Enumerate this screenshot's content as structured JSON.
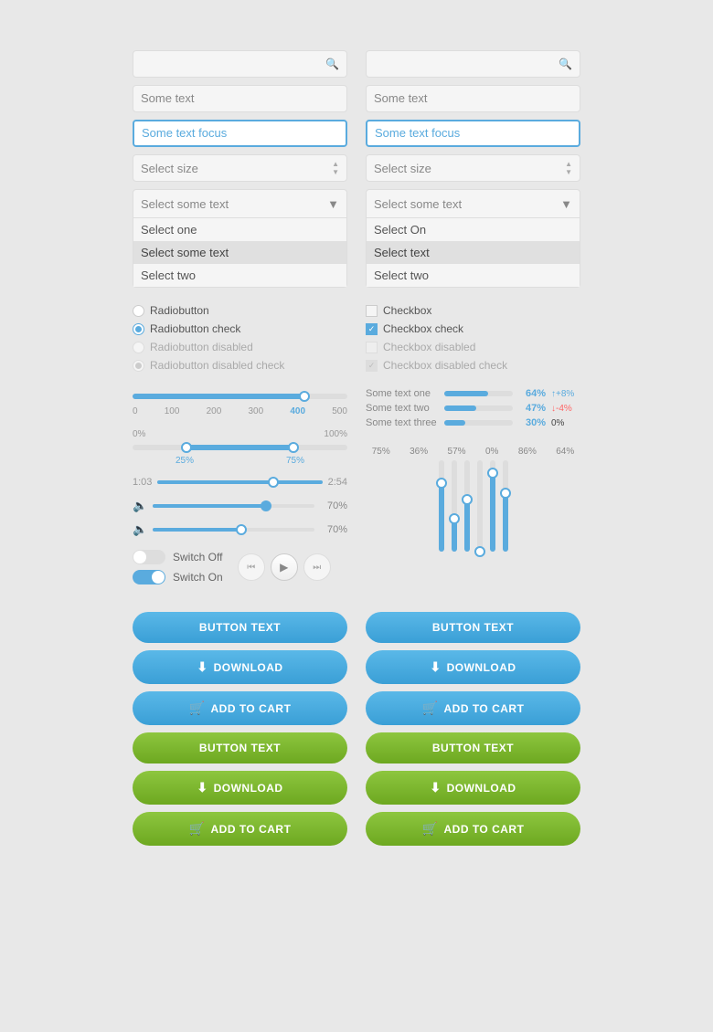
{
  "left": {
    "search_placeholder": "Search",
    "text_input": "Some text",
    "text_focus": "Some text focus",
    "select_size": "Select size",
    "dropdown_header": "Select some text",
    "dropdown_options": [
      "Select one",
      "Select some text",
      "Select two"
    ],
    "dropdown_selected_index": 1,
    "radio": {
      "items": [
        {
          "label": "Radiobutton",
          "state": "normal"
        },
        {
          "label": "Radiobutton check",
          "state": "checked"
        },
        {
          "label": "Radiobutton disabled",
          "state": "disabled"
        },
        {
          "label": "Radiobutton disabled check",
          "state": "disabled-checked"
        }
      ]
    },
    "slider": {
      "labels": [
        "0",
        "100",
        "200",
        "300",
        "400",
        "500"
      ],
      "highlight": "400",
      "thumb_pct": 80
    },
    "dual_slider": {
      "min_label": "0%",
      "max_label": "100%",
      "range_start": 25,
      "range_end": 75,
      "label_start": "25%",
      "label_end": "75%"
    },
    "time_slider": {
      "start": "1:03",
      "end": "2:54",
      "thumb_pct": 60
    },
    "vol1": {
      "icon": "🔈",
      "pct": "70%",
      "fill": 70
    },
    "vol2": {
      "icon": "🔈",
      "pct": "70%",
      "fill": 55
    },
    "switches": [
      {
        "label": "Switch Off",
        "on": false
      },
      {
        "label": "Switch On",
        "on": true
      }
    ],
    "media": {
      "prev": "⏮",
      "play": "▶",
      "next": "⏭"
    },
    "buttons": [
      {
        "label": "BUTTON TEXT",
        "type": "blue",
        "icon": null
      },
      {
        "label": "DOWNLOAD",
        "type": "blue",
        "icon": "⬇"
      },
      {
        "label": "ADD TO CART",
        "type": "blue",
        "icon": "🛒"
      },
      {
        "label": "BUTTON TEXT",
        "type": "green",
        "icon": null
      },
      {
        "label": "DOWNLOAD",
        "type": "green",
        "icon": "⬇"
      },
      {
        "label": "ADD TO CART",
        "type": "green",
        "icon": "🛒"
      }
    ]
  },
  "right": {
    "search_placeholder": "Search",
    "text_input": "Some text",
    "text_focus": "Some text focus",
    "select_size": "Select size",
    "dropdown_header": "Select some text",
    "dropdown_options": [
      "Select On",
      "Select text",
      "Select two"
    ],
    "dropdown_selected_index": 1,
    "checkbox": {
      "items": [
        {
          "label": "Checkbox",
          "state": "normal"
        },
        {
          "label": "Checkbox check",
          "state": "checked"
        },
        {
          "label": "Checkbox disabled",
          "state": "disabled"
        },
        {
          "label": "Checkbox disabled check",
          "state": "disabled-checked"
        }
      ]
    },
    "progress_bars": [
      {
        "label": "Some text one",
        "pct": 64,
        "delta": "+8%",
        "delta_type": "pos"
      },
      {
        "label": "Some text two",
        "pct": 47,
        "delta": "-4%",
        "delta_type": "neg"
      },
      {
        "label": "Some text three",
        "pct": 30,
        "delta": "0%",
        "delta_type": "neutral"
      }
    ],
    "vert_sliders": [
      {
        "pct": "75%",
        "fill": 75
      },
      {
        "pct": "36%",
        "fill": 36
      },
      {
        "pct": "57%",
        "fill": 57
      },
      {
        "pct": "0%",
        "fill": 0
      },
      {
        "pct": "86%",
        "fill": 86
      },
      {
        "pct": "64%",
        "fill": 64
      }
    ],
    "buttons": [
      {
        "label": "BUTTON TEXT",
        "type": "blue",
        "icon": null
      },
      {
        "label": "DOWNLOAD",
        "type": "blue",
        "icon": "⬇"
      },
      {
        "label": "ADD TO CART",
        "type": "blue",
        "icon": "🛒"
      },
      {
        "label": "BUTTON TEXT",
        "type": "green",
        "icon": null
      },
      {
        "label": "DOWNLOAD",
        "type": "green",
        "icon": "⬇"
      },
      {
        "label": "ADD TO CART",
        "type": "green",
        "icon": "🛒"
      }
    ]
  }
}
